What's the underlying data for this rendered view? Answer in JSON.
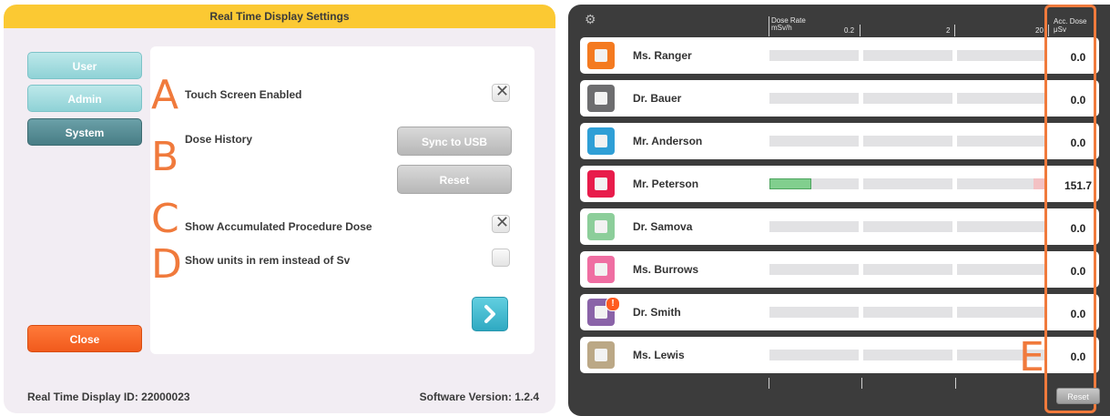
{
  "settings": {
    "title": "Real Time Display Settings",
    "nav": {
      "user": "User",
      "admin": "Admin",
      "system": "System",
      "close": "Close"
    },
    "options": {
      "touch_screen": "Touch Screen Enabled",
      "dose_history": "Dose History",
      "show_accumulated": "Show Accumulated Procedure Dose",
      "show_units": "Show units in rem instead of Sv"
    },
    "checks": {
      "touch_screen": "✕",
      "show_accumulated": "✕",
      "show_units": ""
    },
    "buttons": {
      "sync": "Sync to USB",
      "reset": "Reset",
      "next": "›"
    },
    "letters": [
      "A",
      "B",
      "C",
      "D"
    ],
    "footer": {
      "display_id": "Real Time Display ID: 22000023",
      "software_version": "Software Version: 1.2.4"
    }
  },
  "monitor": {
    "header": {
      "dose_rate": "Dose Rate",
      "dose_rate_unit": "mSv/h",
      "tick_02": "0.2",
      "tick_2": "2",
      "tick_20": "20",
      "acc_dose": "Acc. Dose",
      "acc_unit": "μSv"
    },
    "gear_icon": "⚙",
    "people": [
      {
        "name": "Ms. Ranger",
        "color": "#f47a20",
        "dose": "0.0",
        "rate_fill": 0,
        "alert": false
      },
      {
        "name": "Dr. Bauer",
        "color": "#6d6d6f",
        "dose": "0.0",
        "rate_fill": 0,
        "alert": false
      },
      {
        "name": "Mr. Anderson",
        "color": "#2f9fd6",
        "dose": "0.0",
        "rate_fill": 0,
        "alert": false
      },
      {
        "name": "Mr. Peterson",
        "color": "#e81c4b",
        "dose": "151.7",
        "rate_fill": 0.47,
        "alert": false
      },
      {
        "name": "Dr. Samova",
        "color": "#8cce9a",
        "dose": "0.0",
        "rate_fill": 0,
        "alert": false
      },
      {
        "name": "Ms. Burrows",
        "color": "#ef6ea2",
        "dose": "0.0",
        "rate_fill": 0,
        "alert": false
      },
      {
        "name": "Dr. Smith",
        "color": "#8a63a8",
        "dose": "0.0",
        "rate_fill": 0,
        "alert": true,
        "alert_text": "!"
      },
      {
        "name": "Ms. Lewis",
        "color": "#bba886",
        "dose": "0.0",
        "rate_fill": 0,
        "alert": false
      }
    ],
    "reset": "Reset",
    "letter_e": "E"
  }
}
